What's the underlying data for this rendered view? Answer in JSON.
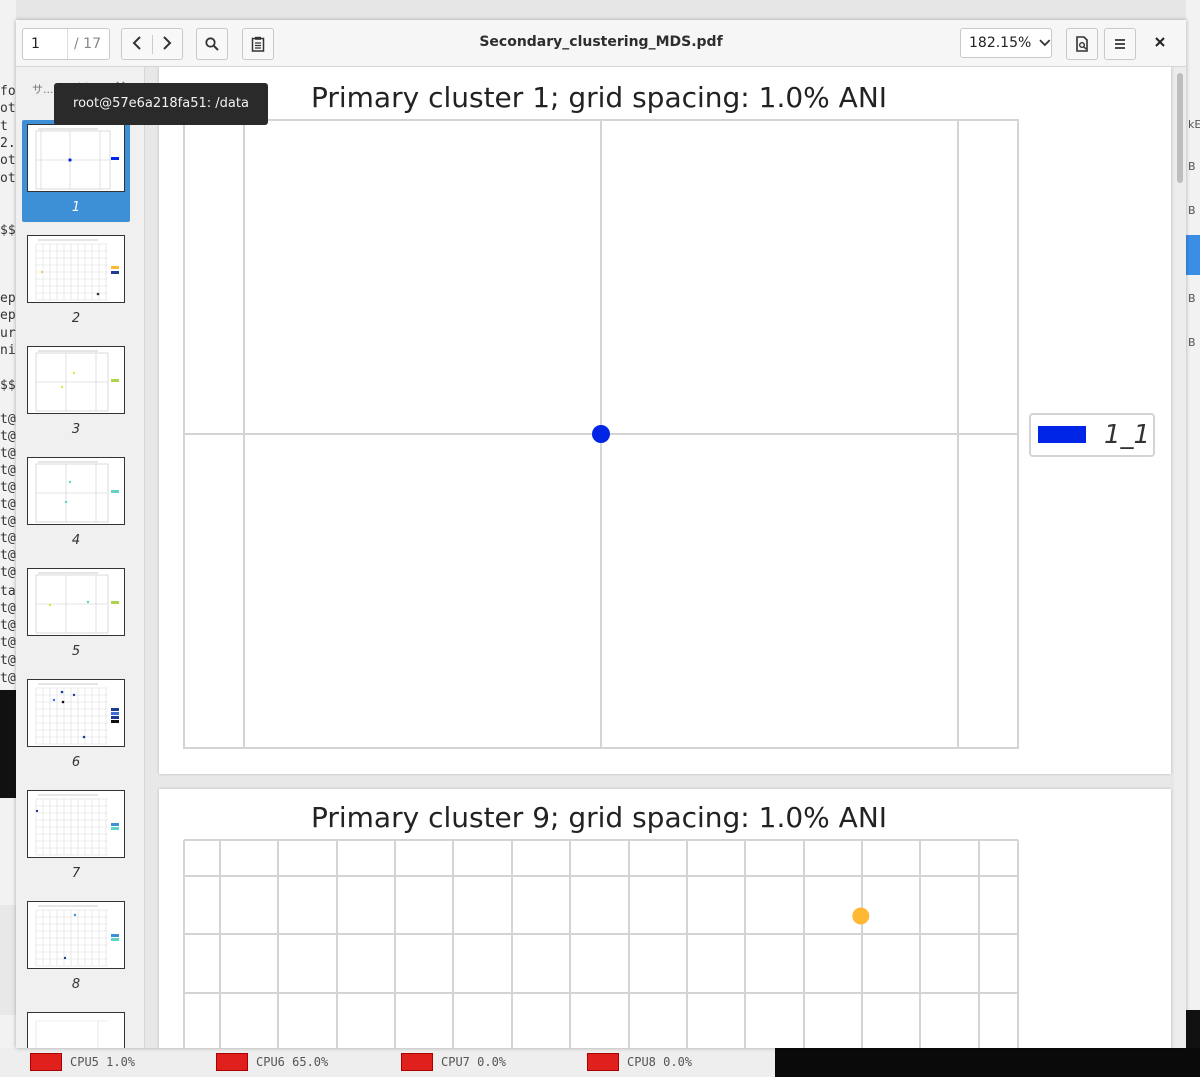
{
  "viewer": {
    "page_current": "1",
    "page_total": "/ 17",
    "doc_title": "Secondary_clustering_MDS.pdf",
    "zoom": "182.15%"
  },
  "tooltip": "root@57e6a218fa51: /data",
  "sidebar": {
    "header_label": "サ...",
    "thumbnails": [
      {
        "num": "1",
        "selected": true
      },
      {
        "num": "2",
        "selected": false
      },
      {
        "num": "3",
        "selected": false
      },
      {
        "num": "4",
        "selected": false
      },
      {
        "num": "5",
        "selected": false
      },
      {
        "num": "6",
        "selected": false
      },
      {
        "num": "7",
        "selected": false
      },
      {
        "num": "8",
        "selected": false
      }
    ]
  },
  "colors": {
    "accent": "#3d8fd6",
    "point_blue": "#0025e6",
    "point_orange": "#ffb833",
    "cpu_red": "#e0201c"
  },
  "background": {
    "cpu_labels": [
      "CPU5 1.0%",
      "CPU6 65.0%",
      "CPU7 0.0%",
      "CPU8 0.0%"
    ]
  },
  "chart_data": [
    {
      "type": "scatter",
      "title": "Primary cluster 1; grid spacing: 1.0% ANI",
      "series": [
        {
          "name": "1_1",
          "color": "#0025e6",
          "points": [
            [
              0,
              0
            ]
          ]
        }
      ],
      "legend": "right",
      "grid": true
    },
    {
      "type": "scatter",
      "title": "Primary cluster 9; grid spacing: 1.0% ANI",
      "series": [
        {
          "color": "#ffb833",
          "points": [
            [
              0.3,
              0.0
            ]
          ]
        }
      ],
      "grid": true
    }
  ]
}
